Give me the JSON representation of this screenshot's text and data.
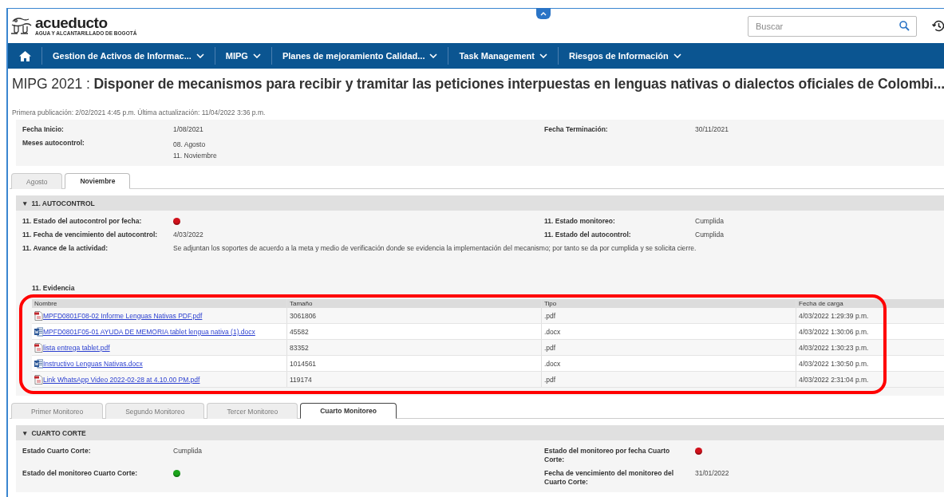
{
  "header": {
    "logo": {
      "name": "acueducto",
      "tagline": "AGUA Y ALCANTARILLADO DE BOGOTÁ"
    },
    "search": {
      "placeholder": "Buscar"
    }
  },
  "nav": [
    {
      "label": "Gestion de Activos de Informac..."
    },
    {
      "label": "MIPG"
    },
    {
      "label": "Planes de mejoramiento Calidad..."
    },
    {
      "label": "Task Management"
    },
    {
      "label": "Riesgos de Información"
    }
  ],
  "title": "MIPG 2021 : **Disponer de mecanismos para recibir y tramitar las peticiones interpuestas en lenguas nativas o dialectos oficiales de Colombi...**",
  "published": "Primera publicación: 2/02/2021 4:45 p.m. Última actualización: 11/04/2022 3:36 p.m.",
  "info": {
    "rows": [
      {
        "cells": [
          {
            "label": "Fecha Inicio:",
            "kind": "text",
            "value": "1/08/2021"
          },
          {
            "label": "Fecha Terminación:",
            "kind": "text",
            "value": "30/11/2021"
          }
        ]
      },
      {
        "cells": [
          {
            "label": "Meses autocontrol:",
            "kind": "lines",
            "lines": [
              "08. Agosto",
              "11. Noviembre"
            ]
          }
        ]
      }
    ]
  },
  "month_tabs": [
    {
      "label": "Agosto",
      "selected": false
    },
    {
      "label": "Noviembre",
      "selected": true
    }
  ],
  "autocontrol": {
    "toggle": "▼",
    "title": "11. AUTOCONTROL",
    "rows": [
      {
        "cells": [
          {
            "label": "11. Estado del autocontrol por fecha:",
            "kind": "status",
            "color": "#d0101a"
          },
          {
            "label": "11. Estado monitoreo:",
            "kind": "text",
            "value": "Cumplida"
          }
        ]
      },
      {
        "cells": [
          {
            "label": "11. Fecha de vencimiento del autocontrol:",
            "kind": "text",
            "value": "4/03/2022"
          },
          {
            "label": "11. Estado del autocontrol:",
            "kind": "text",
            "value": "Cumplida"
          }
        ]
      },
      {
        "cells": [
          {
            "label": "11. Avance de la actividad:",
            "kind": "wide",
            "value": "Se adjuntan los soportes de acuerdo  a la meta y medio de verificación donde se evidencia la implementación del mecanismo; por tanto se da por cumplida y se solicita cierre."
          }
        ]
      }
    ],
    "evidence": {
      "label": "11. Evidencia",
      "columns": [
        "Nombre",
        "Tamaño",
        "Tipo",
        "Fecha de carga"
      ],
      "rows": [
        {
          "kind": "pdf",
          "name": "MPFD0801F08-02 Informe Lenguas Nativas PDF.pdf",
          "size": "3061806",
          "type": ".pdf",
          "date": "4/03/2022 1:29:39 p.m."
        },
        {
          "kind": "word",
          "name": "MPFD0801F05-01 AYUDA DE MEMORIA tablet lengua nativa (1).docx",
          "size": "45582",
          "type": ".docx",
          "date": "4/03/2022 1:30:06 p.m."
        },
        {
          "kind": "pdf",
          "name": "lista entrega tablet.pdf",
          "size": "83352",
          "type": ".pdf",
          "date": "4/03/2022 1:30:23 p.m."
        },
        {
          "kind": "word",
          "name": "Instructivo Lenguas Nativas.docx",
          "size": "1014561",
          "type": ".docx",
          "date": "4/03/2022 1:30:50 p.m."
        },
        {
          "kind": "pdf",
          "name": "Link WhatsApp Video 2022-02-28 at 4.10.00 PM.pdf",
          "size": "119174",
          "type": ".pdf",
          "date": "4/03/2022 2:31:04 p.m."
        }
      ]
    }
  },
  "monitor_tabs": [
    {
      "label": "Primer Monitoreo",
      "selected": false
    },
    {
      "label": "Segundo Monitoreo",
      "selected": false
    },
    {
      "label": "Tercer Monitoreo",
      "selected": false
    },
    {
      "label": "Cuarto Monitoreo",
      "selected": true
    }
  ],
  "corte": {
    "toggle": "▼",
    "title": "CUARTO CORTE",
    "rows": [
      {
        "cells": [
          {
            "label": "Estado Cuarto Corte:",
            "kind": "text",
            "value": "Cumplida"
          },
          {
            "label": "Estado del monitoreo por fecha Cuarto Corte:",
            "kind": "status",
            "color": "#d0101a"
          }
        ]
      },
      {
        "cells": [
          {
            "label": "Estado del monitoreo Cuarto Corte:",
            "kind": "status",
            "color": "#1aa31a"
          },
          {
            "label": "Fecha de vencimiento del monitoreo del Cuarto Corte:",
            "kind": "text",
            "value": "31/01/2022"
          }
        ]
      }
    ]
  }
}
